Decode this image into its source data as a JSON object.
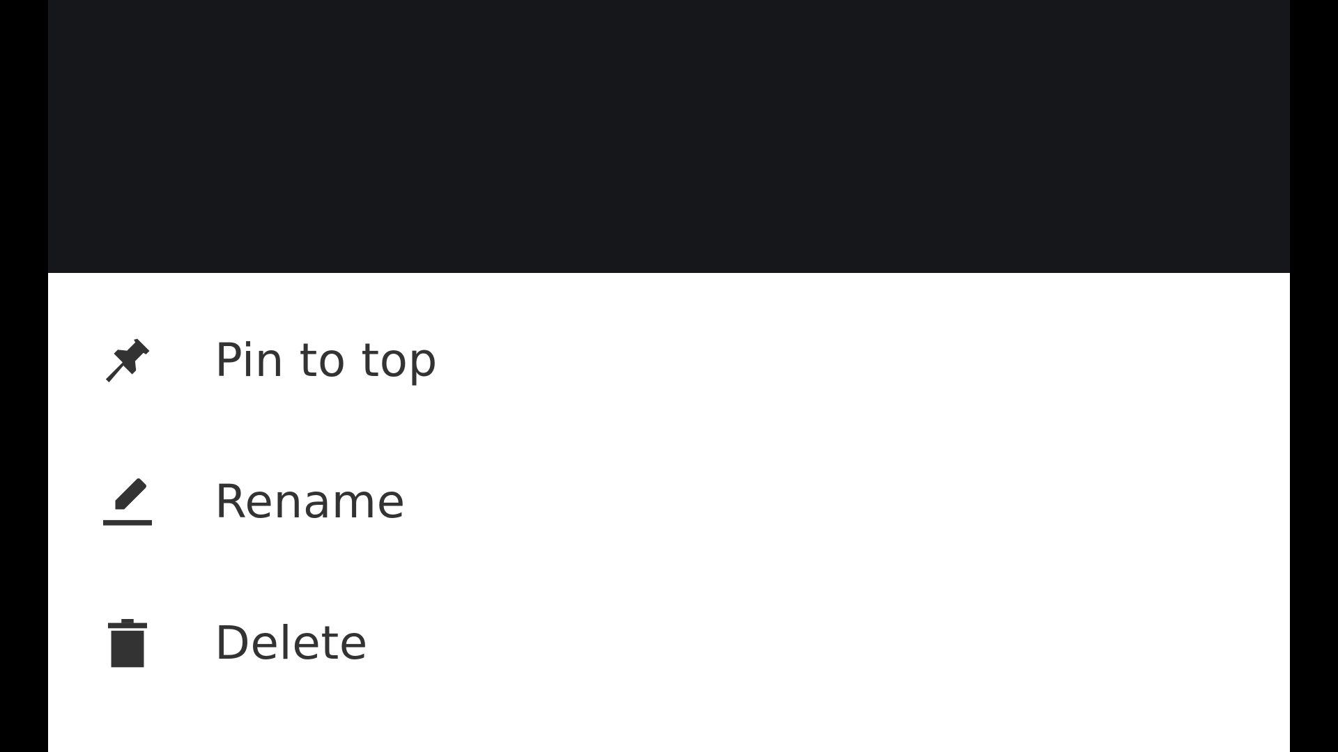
{
  "colors": {
    "scrim": "#16171b",
    "sheet": "#ffffff",
    "text": "#333333",
    "outer": "#000000"
  },
  "menu": {
    "items": [
      {
        "label": "Pin to top",
        "icon": "pin-icon"
      },
      {
        "label": "Rename",
        "icon": "edit-icon"
      },
      {
        "label": "Delete",
        "icon": "trash-icon"
      }
    ]
  }
}
